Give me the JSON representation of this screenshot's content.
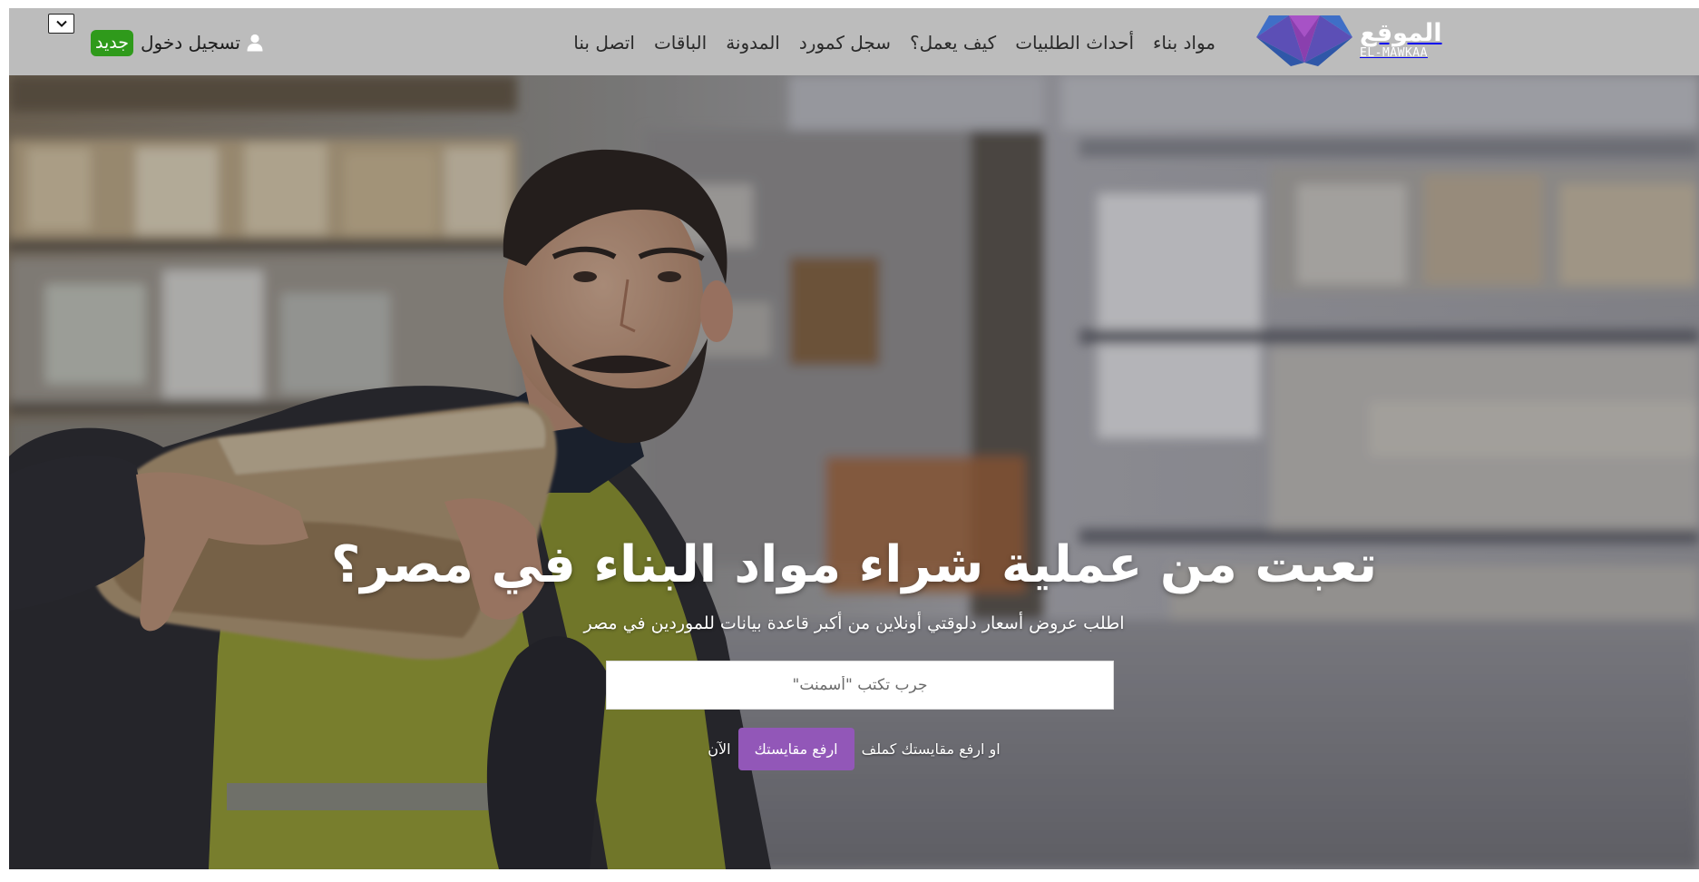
{
  "header": {
    "logo": {
      "arabic": "الموقع",
      "latin": "EL-MAWKAA"
    },
    "nav": [
      {
        "label": "مواد بناء"
      },
      {
        "label": "أحداث الطلبيات"
      },
      {
        "label": "كيف يعمل؟"
      },
      {
        "label": "سجل كمورد"
      },
      {
        "label": "المدونة"
      },
      {
        "label": "الباقات"
      },
      {
        "label": "اتصل بنا"
      }
    ],
    "login_label": "تسجيل دخول",
    "new_badge": "جديد",
    "icons": {
      "user": "user-icon",
      "language_dropdown": "chevron-down-icon"
    }
  },
  "hero": {
    "title": "تعبت من عملية شراء مواد البناء في مصر؟",
    "subtitle": "اطلب عروض أسعار دلوقتي أونلاين من أكبر قاعدة بيانات للموردين في مصر",
    "search": {
      "value": "",
      "placeholder": "جرب تكتب \"أسمنت\""
    },
    "cta": {
      "prefix": "او ارفع مقايستك كملف",
      "button_label": "ارفع مقايستك",
      "suffix": "الآن"
    }
  },
  "colors": {
    "navbar_bg": "#bcbcbc",
    "badge_green": "#2f9a1b",
    "accent_purple": "#9257b8",
    "logo_purple": "#7b3fa8",
    "logo_blue": "#3b6fc9"
  }
}
